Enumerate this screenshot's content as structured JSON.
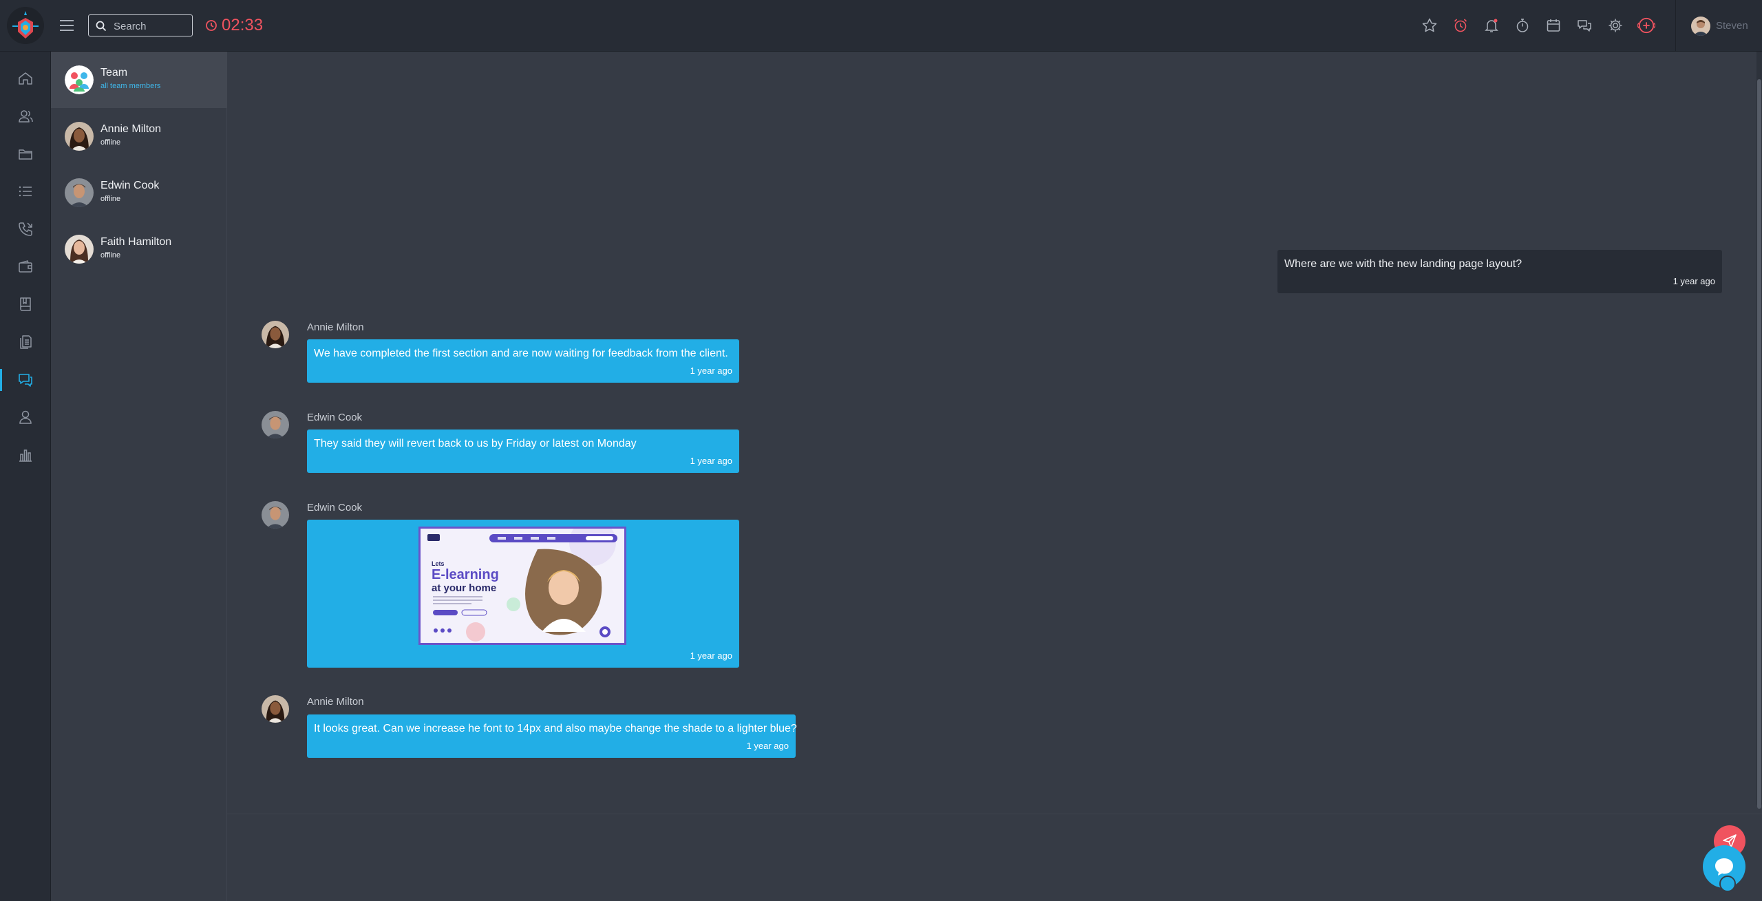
{
  "header": {
    "search": {
      "placeholder": "Search"
    },
    "timer": "02:33",
    "icons": [
      "star-icon",
      "alarm-clock-icon",
      "bell-icon",
      "stopwatch-icon",
      "calendar-icon",
      "chat-icon",
      "gear-icon",
      "add-circle-icon"
    ],
    "user": {
      "name": "Steven"
    }
  },
  "rail": {
    "items": [
      "home-icon",
      "contacts-icon",
      "folder-icon",
      "list-icon",
      "phone-icon",
      "wallet-icon",
      "book-icon",
      "documents-icon",
      "chat-icon",
      "user-icon",
      "bar-chart-icon"
    ],
    "active_index": 8
  },
  "contacts": [
    {
      "name": "Team",
      "status": "all team members"
    },
    {
      "name": "Annie Milton",
      "status": "offline"
    },
    {
      "name": "Edwin Cook",
      "status": "offline"
    },
    {
      "name": "Faith Hamilton",
      "status": "offline"
    }
  ],
  "messages": [
    {
      "sender": "",
      "text": "Where are we with the new landing page layout?",
      "time": "1 year ago"
    },
    {
      "sender": "Annie Milton",
      "text": "We have completed the first section and are now waiting for feedback from the client.",
      "time": "1 year ago"
    },
    {
      "sender": "Edwin Cook",
      "text": "They said they will revert back to us by Friday or latest on Monday",
      "time": "1 year ago"
    },
    {
      "sender": "Edwin Cook",
      "image": {
        "line1": "Lets",
        "line2": "E-learning",
        "line3": "at your home"
      },
      "time": "1 year ago"
    },
    {
      "sender": "Annie Milton",
      "text": "It looks great. Can we increase he font to 14px and also maybe change the shade to a lighter blue?",
      "time": "1 year ago"
    }
  ],
  "colors": {
    "accent": "#22aee6",
    "danger": "#f0535f",
    "panel": "#272c35",
    "background": "#363b45"
  }
}
